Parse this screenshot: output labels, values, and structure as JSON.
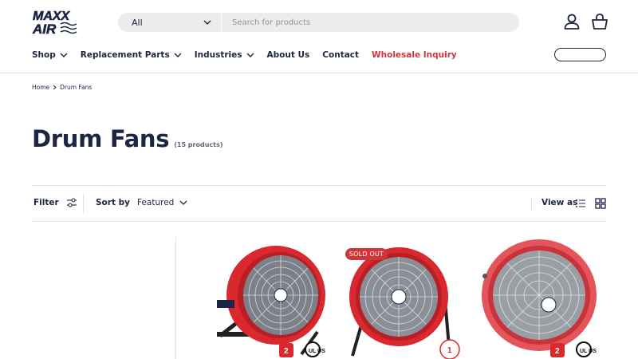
{
  "brand": {
    "logo_line1": "MAXX",
    "logo_line2": "AIR"
  },
  "search": {
    "category": "All",
    "placeholder": "Search for products"
  },
  "nav": {
    "items": [
      {
        "label": "Shop",
        "has_dropdown": true
      },
      {
        "label": "Replacement Parts",
        "has_dropdown": true
      },
      {
        "label": "Industries",
        "has_dropdown": true
      },
      {
        "label": "About Us",
        "has_dropdown": false
      },
      {
        "label": "Contact",
        "has_dropdown": false
      },
      {
        "label": "Wholesale Inquiry",
        "has_dropdown": false
      }
    ]
  },
  "icons": {
    "account": "account-icon",
    "cart": "cart-icon"
  },
  "breadcrumb": {
    "home": "Home",
    "current": "Drum Fans"
  },
  "collection": {
    "title": "Drum Fans",
    "count": "(15 products)"
  },
  "toolbar": {
    "filter_label": "Filter",
    "sort_label": "Sort by",
    "sort_value": "Featured",
    "view_label": "View as"
  },
  "products": [
    {
      "badge": "",
      "warranty_years": "2",
      "cert": "UL US"
    },
    {
      "badge": "SOLD OUT",
      "warranty_years": "1",
      "cert": ""
    },
    {
      "badge": "",
      "warranty_years": "2",
      "cert": "UL US"
    }
  ],
  "colors": {
    "navy": "#1c2544",
    "accent_red": "#d0353a",
    "fan_red": "#d9282e"
  }
}
